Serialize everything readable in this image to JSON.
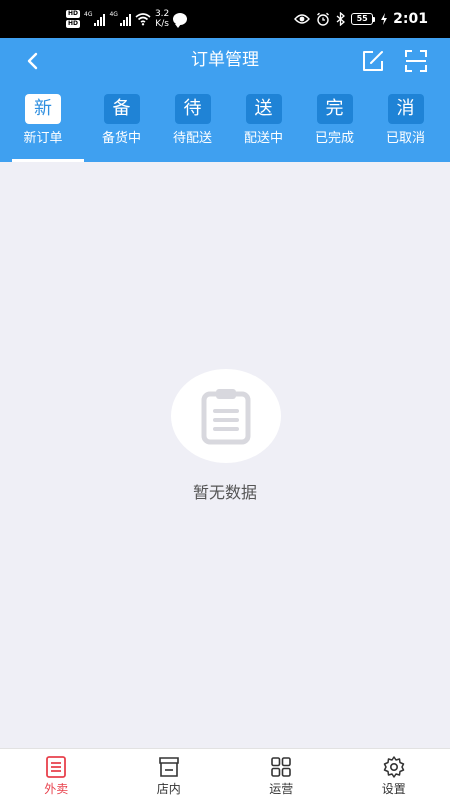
{
  "status_bar": {
    "hd1": "HD",
    "hd2": "HD",
    "net1": "4G",
    "net2": "4G",
    "speed_value": "3.2",
    "speed_unit": "K/s",
    "battery": "55",
    "time": "2:01"
  },
  "header": {
    "title": "订单管理",
    "icons": {
      "back": "chevron-left-icon",
      "edit": "edit-icon",
      "scan": "scan-icon"
    }
  },
  "tabs": [
    {
      "badge": "新",
      "label": "新订单",
      "active": true
    },
    {
      "badge": "备",
      "label": "备货中",
      "active": false
    },
    {
      "badge": "待",
      "label": "待配送",
      "active": false
    },
    {
      "badge": "送",
      "label": "配送中",
      "active": false
    },
    {
      "badge": "完",
      "label": "已完成",
      "active": false
    },
    {
      "badge": "消",
      "label": "已取消",
      "active": false
    }
  ],
  "empty_state": {
    "icon": "clipboard-icon",
    "text": "暂无数据"
  },
  "bottom_nav": [
    {
      "label": "外卖",
      "icon": "list-icon",
      "active": true
    },
    {
      "label": "店内",
      "icon": "store-icon",
      "active": false
    },
    {
      "label": "运营",
      "icon": "grid-icon",
      "active": false
    },
    {
      "label": "设置",
      "icon": "gear-icon",
      "active": false
    }
  ],
  "colors": {
    "header_bg": "#3fa0f0",
    "badge_bg": "#1f83d6",
    "active_nav": "#e8414c",
    "content_bg": "#efeff6"
  }
}
